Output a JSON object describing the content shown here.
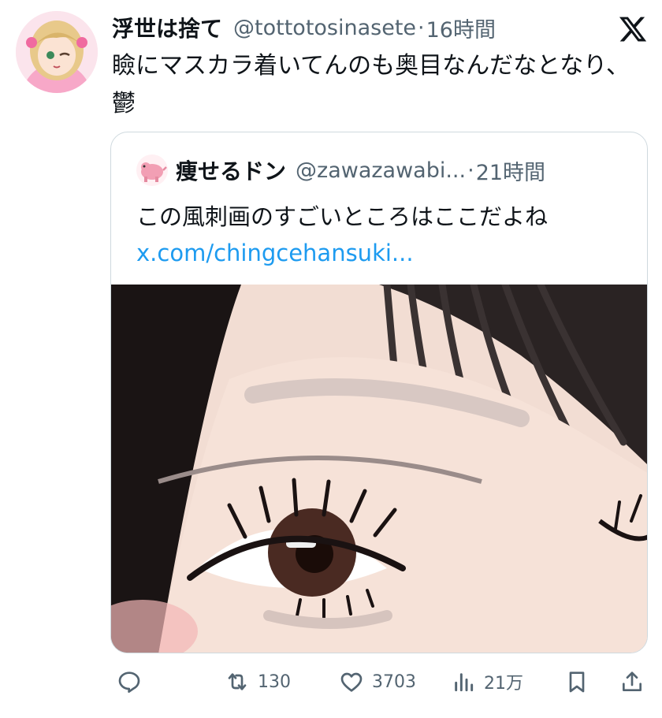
{
  "tweet": {
    "author": {
      "display_name": "浮世は捨て",
      "handle": "@tottotosinasete",
      "time": "16時間"
    },
    "separator": "·",
    "text": "瞼にマスカラ着いてんのも奥目なんだなとなり、鬱",
    "platform_icon": "x-logo-icon"
  },
  "quote": {
    "author": {
      "display_name": "痩せるドン",
      "handle": "@zawazawabi...",
      "time": "21時間"
    },
    "separator": "·",
    "text": "この風刺画のすごいところはここだよね",
    "link": "x.com/chingcehansuki..."
  },
  "actions": {
    "reply": {
      "icon": "reply-icon",
      "count": ""
    },
    "retweet": {
      "icon": "retweet-icon",
      "count": "130"
    },
    "like": {
      "icon": "heart-icon",
      "count": "3703"
    },
    "views": {
      "icon": "views-icon",
      "count": "21万"
    },
    "bookmark": {
      "icon": "bookmark-icon"
    },
    "share": {
      "icon": "share-icon"
    }
  },
  "colors": {
    "text": "#0f1419",
    "secondary": "#536471",
    "link": "#1d9bf0",
    "border": "#cfd9de"
  }
}
